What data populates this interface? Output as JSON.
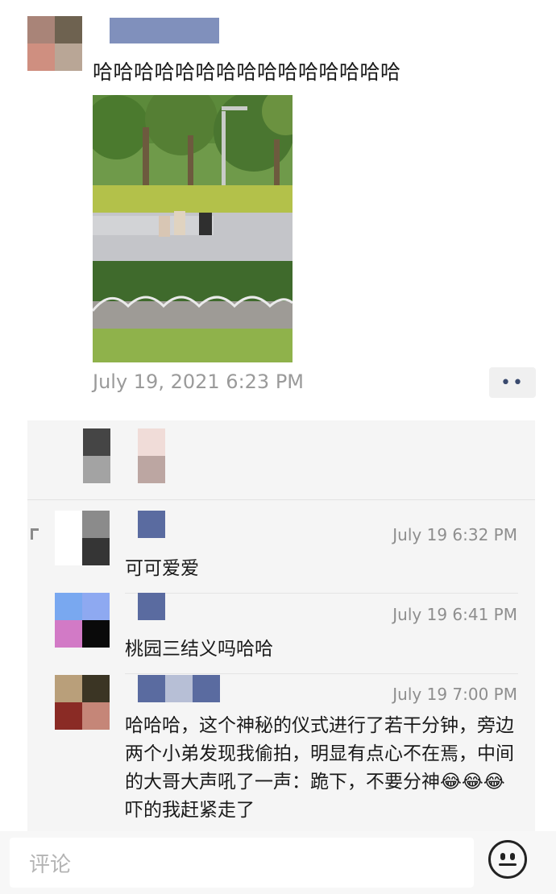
{
  "post": {
    "text": "哈哈哈哈哈哈哈哈哈哈哈哈哈哈哈",
    "timestamp": "July 19, 2021 6:23 PM",
    "more_label": "••"
  },
  "comments": [
    {
      "time": "July 19 6:32 PM",
      "text": "可可爱爱"
    },
    {
      "time": "July 19 6:41 PM",
      "text": "桃园三结义吗哈哈"
    },
    {
      "time": "July 19 7:00 PM",
      "text": "哈哈哈，这个神秘的仪式进行了若干分钟，旁边两个小弟发现我偷拍，明显有点心不在焉，中间的大哥大声吼了一声：跪下，不要分神😂😂😂吓的我赶紧走了"
    }
  ],
  "input": {
    "placeholder": "评论"
  },
  "icons": {
    "emoji": "smiley-face-icon"
  },
  "colors": {
    "name_blue": "#56699c",
    "timestamp_gray": "#9a9a9a",
    "panel_bg": "#f5f5f5"
  }
}
